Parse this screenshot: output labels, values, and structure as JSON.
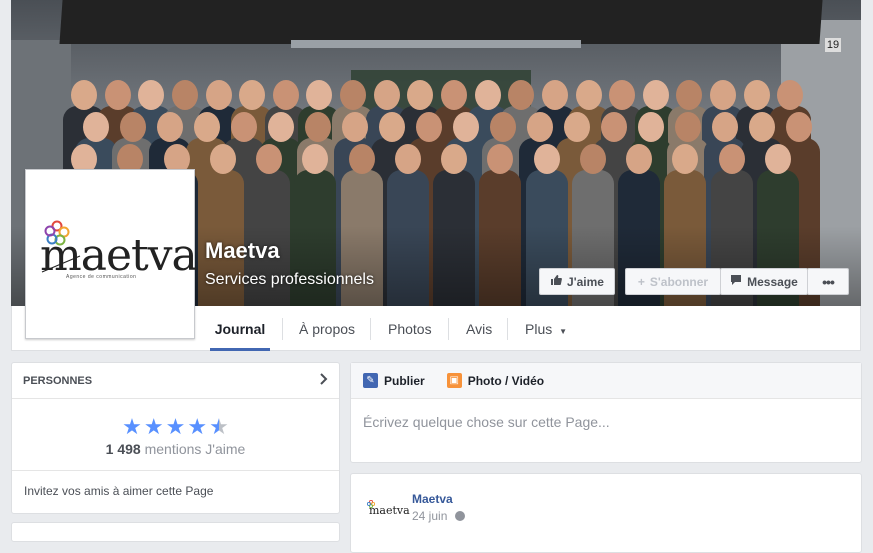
{
  "page": {
    "name": "Maetva",
    "category": "Services professionnels",
    "logo_text": "maetva",
    "logo_subtext": "Agence de communication",
    "cover_door_number": "19"
  },
  "cover_buttons": {
    "like": "J'aime",
    "subscribe": "S'abonner",
    "message": "Message",
    "more": "•••"
  },
  "tabs": [
    {
      "label": "Journal",
      "active": true
    },
    {
      "label": "À propos"
    },
    {
      "label": "Photos"
    },
    {
      "label": "Avis"
    },
    {
      "label": "Plus"
    }
  ],
  "people_card": {
    "title": "PERSONNES",
    "rating": 4.5,
    "like_count": "1 498",
    "like_suffix": "mentions J'aime",
    "invite": "Invitez vos amis à aimer cette Page"
  },
  "composer": {
    "publish": "Publier",
    "photo_video": "Photo / Vidéo",
    "placeholder": "Écrivez quelque chose sur cette Page..."
  },
  "post": {
    "author": "Maetva",
    "date": "24 juin",
    "logo_text": "maetva"
  },
  "colors": {
    "fb_blue": "#4267b2",
    "link_blue": "#365899",
    "star_blue": "#5890ff",
    "background": "#e9ebee"
  },
  "icons": {
    "like": "thumbs-up-icon",
    "subscribe": "plus-icon",
    "message": "speech-bubble-icon",
    "more_caret": "caret-down-icon",
    "chevron": "chevron-right-icon",
    "publish": "pencil-icon",
    "photo": "photo-icon",
    "audience": "globe-icon"
  }
}
